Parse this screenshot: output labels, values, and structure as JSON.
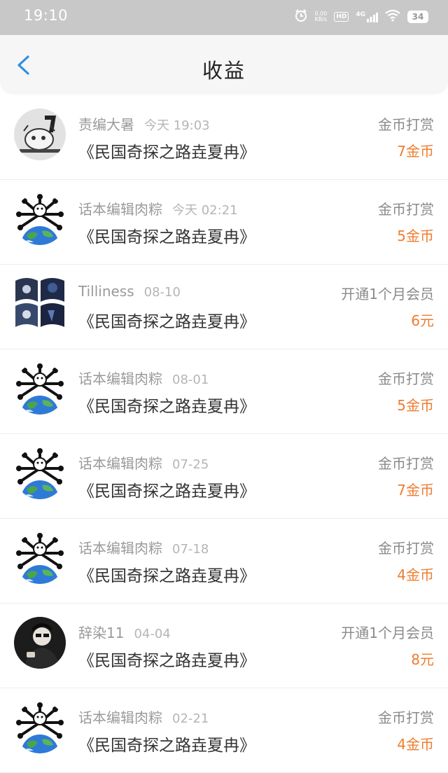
{
  "status_bar": {
    "time": "19:10",
    "speed": "0.00",
    "speed_unit": "KB/s",
    "hd": "HD",
    "network": "4G",
    "battery": "34"
  },
  "header": {
    "title": "收益",
    "back_icon": "chevron-left-icon"
  },
  "colors": {
    "accent": "#2f8fe0",
    "amount": "#ee7c2e"
  },
  "items": [
    {
      "name": "责编大暑",
      "time": "今天 19:03",
      "book": "《民国奇探之路垚夏冉》",
      "type": "金币打赏",
      "amount": "7金币"
    },
    {
      "name": "话本编辑肉粽",
      "time": "今天 02:21",
      "book": "《民国奇探之路垚夏冉》",
      "type": "金币打赏",
      "amount": "5金币"
    },
    {
      "name": "Tilliness",
      "time": "08-10",
      "book": "《民国奇探之路垚夏冉》",
      "type": "开通1个月会员",
      "amount": "6元"
    },
    {
      "name": "话本编辑肉粽",
      "time": "08-01",
      "book": "《民国奇探之路垚夏冉》",
      "type": "金币打赏",
      "amount": "5金币"
    },
    {
      "name": "话本编辑肉粽",
      "time": "07-25",
      "book": "《民国奇探之路垚夏冉》",
      "type": "金币打赏",
      "amount": "7金币"
    },
    {
      "name": "话本编辑肉粽",
      "time": "07-18",
      "book": "《民国奇探之路垚夏冉》",
      "type": "金币打赏",
      "amount": "4金币"
    },
    {
      "name": "辞染11",
      "time": "04-04",
      "book": "《民国奇探之路垚夏冉》",
      "type": "开通1个月会员",
      "amount": "8元"
    },
    {
      "name": "话本编辑肉粽",
      "time": "02-21",
      "book": "《民国奇探之路垚夏冉》",
      "type": "金币打赏",
      "amount": "4金币"
    }
  ]
}
